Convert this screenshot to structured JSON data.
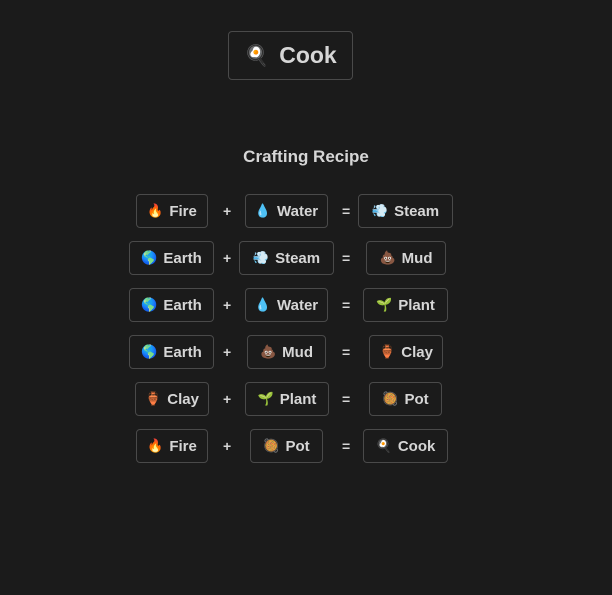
{
  "target": {
    "emoji": "🍳",
    "label": "Cook"
  },
  "heading": "Crafting Recipe",
  "operators": {
    "plus": "+",
    "equals": "="
  },
  "recipes": [
    {
      "a": {
        "emoji": "🔥",
        "label": "Fire"
      },
      "b": {
        "emoji": "💧",
        "label": "Water"
      },
      "result": {
        "emoji": "💨",
        "label": "Steam"
      }
    },
    {
      "a": {
        "emoji": "🌎",
        "label": "Earth"
      },
      "b": {
        "emoji": "💨",
        "label": "Steam"
      },
      "result": {
        "emoji": "💩",
        "label": "Mud"
      }
    },
    {
      "a": {
        "emoji": "🌎",
        "label": "Earth"
      },
      "b": {
        "emoji": "💧",
        "label": "Water"
      },
      "result": {
        "emoji": "🌱",
        "label": "Plant"
      }
    },
    {
      "a": {
        "emoji": "🌎",
        "label": "Earth"
      },
      "b": {
        "emoji": "💩",
        "label": "Mud"
      },
      "result": {
        "emoji": "🏺",
        "label": "Clay"
      }
    },
    {
      "a": {
        "emoji": "🏺",
        "label": "Clay"
      },
      "b": {
        "emoji": "🌱",
        "label": "Plant"
      },
      "result": {
        "emoji": "🥘",
        "label": "Pot"
      }
    },
    {
      "a": {
        "emoji": "🔥",
        "label": "Fire"
      },
      "b": {
        "emoji": "🥘",
        "label": "Pot"
      },
      "result": {
        "emoji": "🍳",
        "label": "Cook"
      }
    }
  ]
}
